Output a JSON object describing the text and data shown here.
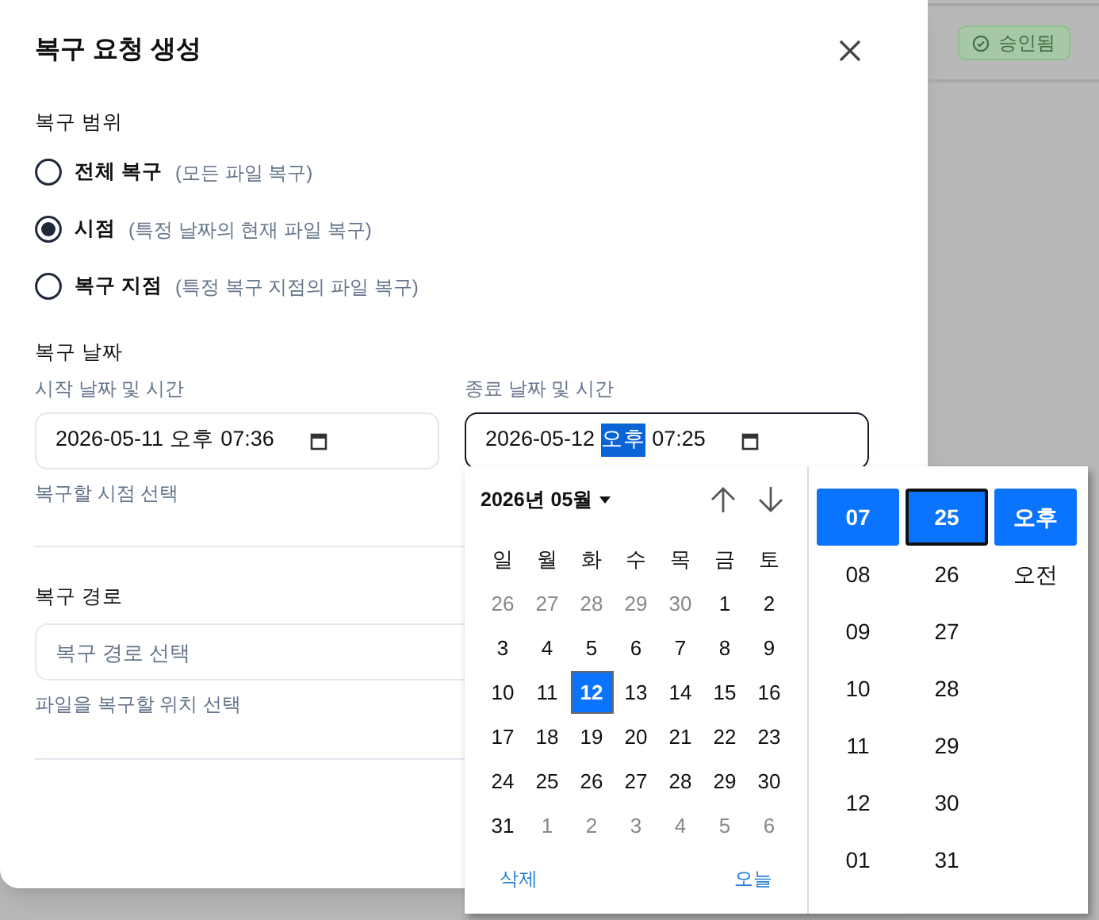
{
  "dialog": {
    "title": "복구 요청 생성",
    "scope": {
      "label": "복구 범위",
      "options": [
        {
          "label": "전체 복구",
          "hint": "(모든 파일 복구)",
          "selected": false
        },
        {
          "label": "시점",
          "hint": "(특정 날짜의 현재 파일 복구)",
          "selected": true
        },
        {
          "label": "복구 지점",
          "hint": "(특정 복구 지점의 파일 복구)",
          "selected": false
        }
      ]
    },
    "date": {
      "label": "복구 날짜",
      "start": {
        "label": "시작 날짜 및 시간",
        "focused": false,
        "segments": [
          {
            "text": "2026-05-11",
            "selected": false
          },
          {
            "text": "오후",
            "selected": false
          },
          {
            "text": "07:36",
            "selected": false
          }
        ]
      },
      "end": {
        "label": "종료 날짜 및 시간",
        "focused": true,
        "segments": [
          {
            "text": "2026-05-12",
            "selected": false
          },
          {
            "text": "오후",
            "selected": true
          },
          {
            "text": "07:25",
            "selected": false
          }
        ]
      },
      "help": "복구할 시점 선택"
    },
    "path": {
      "label": "복구 경로",
      "placeholder": "복구 경로 선택",
      "help": "파일을 복구할 위치 선택"
    }
  },
  "status_badge": "승인됨",
  "picker": {
    "month": "2026년 05월",
    "weekdays": [
      "일",
      "월",
      "화",
      "수",
      "목",
      "금",
      "토"
    ],
    "weeks": [
      [
        {
          "day": "26",
          "outside": true,
          "selected": false
        },
        {
          "day": "27",
          "outside": true,
          "selected": false
        },
        {
          "day": "28",
          "outside": true,
          "selected": false
        },
        {
          "day": "29",
          "outside": true,
          "selected": false
        },
        {
          "day": "30",
          "outside": true,
          "selected": false
        },
        {
          "day": "1",
          "outside": false,
          "selected": false
        },
        {
          "day": "2",
          "outside": false,
          "selected": false
        }
      ],
      [
        {
          "day": "3",
          "outside": false,
          "selected": false
        },
        {
          "day": "4",
          "outside": false,
          "selected": false
        },
        {
          "day": "5",
          "outside": false,
          "selected": false
        },
        {
          "day": "6",
          "outside": false,
          "selected": false
        },
        {
          "day": "7",
          "outside": false,
          "selected": false
        },
        {
          "day": "8",
          "outside": false,
          "selected": false
        },
        {
          "day": "9",
          "outside": false,
          "selected": false
        }
      ],
      [
        {
          "day": "10",
          "outside": false,
          "selected": false
        },
        {
          "day": "11",
          "outside": false,
          "selected": false
        },
        {
          "day": "12",
          "outside": false,
          "selected": true
        },
        {
          "day": "13",
          "outside": false,
          "selected": false
        },
        {
          "day": "14",
          "outside": false,
          "selected": false
        },
        {
          "day": "15",
          "outside": false,
          "selected": false
        },
        {
          "day": "16",
          "outside": false,
          "selected": false
        }
      ],
      [
        {
          "day": "17",
          "outside": false,
          "selected": false
        },
        {
          "day": "18",
          "outside": false,
          "selected": false
        },
        {
          "day": "19",
          "outside": false,
          "selected": false
        },
        {
          "day": "20",
          "outside": false,
          "selected": false
        },
        {
          "day": "21",
          "outside": false,
          "selected": false
        },
        {
          "day": "22",
          "outside": false,
          "selected": false
        },
        {
          "day": "23",
          "outside": false,
          "selected": false
        }
      ],
      [
        {
          "day": "24",
          "outside": false,
          "selected": false
        },
        {
          "day": "25",
          "outside": false,
          "selected": false
        },
        {
          "day": "26",
          "outside": false,
          "selected": false
        },
        {
          "day": "27",
          "outside": false,
          "selected": false
        },
        {
          "day": "28",
          "outside": false,
          "selected": false
        },
        {
          "day": "29",
          "outside": false,
          "selected": false
        },
        {
          "day": "30",
          "outside": false,
          "selected": false
        }
      ],
      [
        {
          "day": "31",
          "outside": false,
          "selected": false
        },
        {
          "day": "1",
          "outside": true,
          "selected": false
        },
        {
          "day": "2",
          "outside": true,
          "selected": false
        },
        {
          "day": "3",
          "outside": true,
          "selected": false
        },
        {
          "day": "4",
          "outside": true,
          "selected": false
        },
        {
          "day": "5",
          "outside": true,
          "selected": false
        },
        {
          "day": "6",
          "outside": true,
          "selected": false
        }
      ]
    ],
    "clear": "삭제",
    "today": "오늘",
    "time_columns": [
      [
        {
          "text": "07",
          "selected": true,
          "focused": false
        },
        {
          "text": "08",
          "selected": false,
          "focused": false
        },
        {
          "text": "09",
          "selected": false,
          "focused": false
        },
        {
          "text": "10",
          "selected": false,
          "focused": false
        },
        {
          "text": "11",
          "selected": false,
          "focused": false
        },
        {
          "text": "12",
          "selected": false,
          "focused": false
        },
        {
          "text": "01",
          "selected": false,
          "focused": false
        }
      ],
      [
        {
          "text": "25",
          "selected": true,
          "focused": true
        },
        {
          "text": "26",
          "selected": false,
          "focused": false
        },
        {
          "text": "27",
          "selected": false,
          "focused": false
        },
        {
          "text": "28",
          "selected": false,
          "focused": false
        },
        {
          "text": "29",
          "selected": false,
          "focused": false
        },
        {
          "text": "30",
          "selected": false,
          "focused": false
        },
        {
          "text": "31",
          "selected": false,
          "focused": false
        }
      ],
      [
        {
          "text": "오후",
          "selected": true,
          "focused": false
        },
        {
          "text": "오전",
          "selected": false,
          "focused": false
        }
      ]
    ]
  }
}
